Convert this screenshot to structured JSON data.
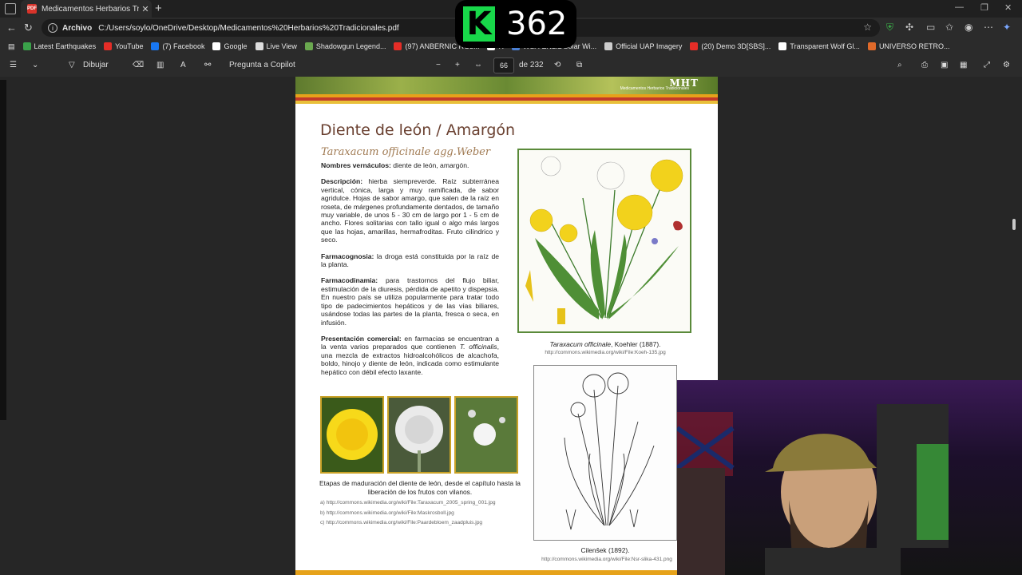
{
  "tab": {
    "title": "Medicamentos Herbarios Tradicio",
    "close": "✕",
    "new": "+"
  },
  "window": {
    "minimize": "—",
    "restore": "❐",
    "close": "✕"
  },
  "address": {
    "label": "Archivo",
    "url": "C:/Users/soylo/OneDrive/Desktop/Medicamentos%20Herbarios%20Tradicionales.pdf"
  },
  "bookmarks": [
    {
      "label": "Latest Earthquakes",
      "color": "#3aa24a"
    },
    {
      "label": "YouTube",
      "color": "#e52d27"
    },
    {
      "label": "(7) Facebook",
      "color": "#1877f2"
    },
    {
      "label": "Google",
      "color": "#ffffff"
    },
    {
      "label": "Live View",
      "color": "#dddddd"
    },
    {
      "label": "Shadowgun Legend...",
      "color": "#6aa84f"
    },
    {
      "label": "(97) ANBERNIC RG3...",
      "color": "#e52d27"
    },
    {
      "label": "R",
      "color": "#ffffff"
    },
    {
      "label": "WSA-ENLIL Solar Wi...",
      "color": "#4a7fd4"
    },
    {
      "label": "Official UAP Imagery",
      "color": "#cccccc"
    },
    {
      "label": "(20) Demo 3D[SBS]...",
      "color": "#e52d27"
    },
    {
      "label": "Transparent Wolf Gl...",
      "color": "#ffffff"
    },
    {
      "label": "UNIVERSO RETRO...",
      "color": "#e06a2a"
    }
  ],
  "pdf_toolbar": {
    "draw": "Dibujar",
    "copilot": "Pregunta a Copilot",
    "page_current": "66",
    "page_total": "de 232"
  },
  "badge": {
    "letter": "K",
    "number": "362",
    "color": "#18d84a"
  },
  "page": {
    "banner_title": "MHT",
    "banner_sub": "Medicamentos Herbarios Tradicionales",
    "title": "Diente de león / Amargón",
    "scientific": "Taraxacum officinale",
    "scientific_author": " agg.Weber",
    "vernacular_label": "Nombres vernáculos:",
    "vernacular": " diente de león, amargón.",
    "desc_label": "Descripción:",
    "desc": " hierba siempreverde. Raíz subterránea vertical, cónica, larga y muy ramificada, de sabor agridulce. Hojas de sabor amargo, que salen de la raíz en roseta, de márgenes profundamente dentados, de tamaño muy variable, de unos 5 - 30 cm de largo por 1 - 5 cm de ancho. Flores solitarias con tallo igual o algo más largos que las hojas, amarillas, hermafroditas. Fruto cilíndrico y seco.",
    "farmacog_label": "Farmacognosia:",
    "farmacog": " la droga está constituida por la raíz de la planta.",
    "farmacod_label": "Farmacodinamia:",
    "farmacod": " para trastornos del flujo biliar, estimulación de la diuresis, pérdida de apetito y dispepsia. En nuestro país se utiliza popularmente para tratar todo tipo de padecimientos hepáticos y de las vías biliares, usándose todas las partes de la planta, fresca o seca, en infusión.",
    "present_label": "Presentación comercial:",
    "present_a": " en farmacias se encuentran a la venta varios preparados que contienen ",
    "present_t": "T. officinalis",
    "present_b": ", una mezcla de extractos hidroalcohólicos de alcachofa, boldo, hinojo y diente de león, indicada como estimulante hepático con débil efecto laxante.",
    "cap1_italic": "Taraxacum officinale",
    "cap1_rest": ", Koehler (1887).",
    "cap1_url": "http://commons.wikimedia.org/wiki/File:Koeh-135.jpg",
    "thumbs_caption": "Etapas de maduración del diente de león, desde el capítulo hasta la liberación de los frutos con vilanos.",
    "thumb_urls": [
      "a) http://commons.wikimedia.org/wiki/File:Taraxacum_2005_spring_001.jpg",
      "b) http://commons.wikimedia.org/wiki/File:Maskrosboll.jpg",
      "c) http://commons.wikimedia.org/wiki/File:Paardebloem_zaadpluis.jpg"
    ],
    "cap2": "Cilenšek (1892).",
    "cap2_url": "http://commons.wikimedia.org/wiki/File:Nsr-slika-431.png"
  }
}
